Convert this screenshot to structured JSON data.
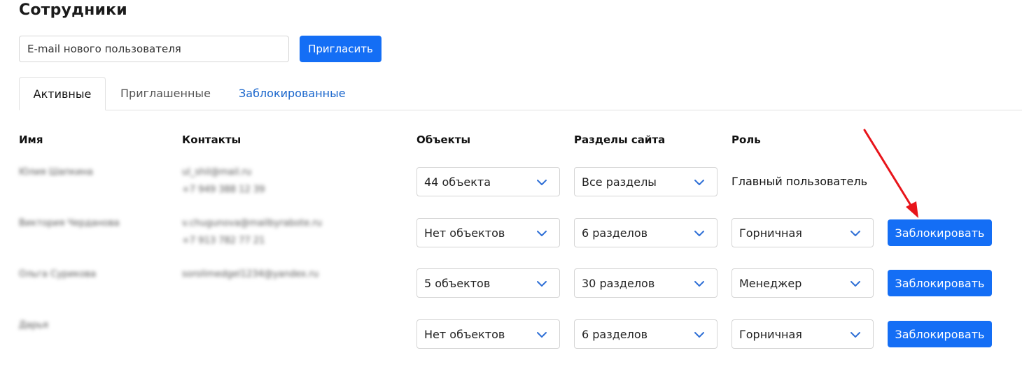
{
  "page": {
    "title": "Сотрудники"
  },
  "invite": {
    "placeholder": "E-mail нового пользователя",
    "button_label": "Пригласить"
  },
  "tabs": [
    {
      "label": "Активные",
      "active": true
    },
    {
      "label": "Приглашенные",
      "active": false
    },
    {
      "label": "Заблокированные",
      "active": false
    }
  ],
  "table": {
    "headers": {
      "name": "Имя",
      "contacts": "Контакты",
      "objects": "Объекты",
      "sections": "Разделы сайта",
      "role": "Роль"
    },
    "rows": [
      {
        "name": "Юлия Шапкина",
        "email": "ul_shil@mail.ru",
        "phone": "+7 949 388 12 39",
        "objects": "44 объекта",
        "sections": "Все разделы",
        "role": "Главный пользователь"
      },
      {
        "name": "Виктория Черданова",
        "email": "v.chugunova@mailbyrabote.ru",
        "phone": "+7 913 782 77 21",
        "objects": "Нет объектов",
        "sections": "6 разделов",
        "role": "Горничная",
        "action": "Заблокировать"
      },
      {
        "name": "Ольга Сурикова",
        "email": "sorolimedgel1234@yandex.ru",
        "objects": "5 объектов",
        "sections": "30 разделов",
        "role": "Менеджер",
        "action": "Заблокировать"
      },
      {
        "name": "Дарья",
        "objects": "Нет объектов",
        "sections": "6 разделов",
        "role": "Горничная",
        "action": "Заблокировать"
      }
    ]
  },
  "colors": {
    "primary": "#146ef5",
    "link": "#1a66cc",
    "annotation_arrow": "#e8141a"
  },
  "icons": {
    "select_chevron": "chevron-down-icon",
    "annotation": "red-arrow-icon"
  }
}
